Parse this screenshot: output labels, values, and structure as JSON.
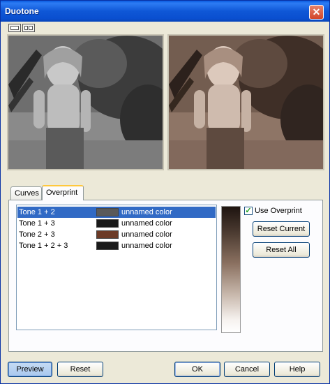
{
  "window": {
    "title": "Duotone",
    "close_glyph": "✕"
  },
  "tabs": [
    {
      "label": "Curves"
    },
    {
      "label": "Overprint"
    }
  ],
  "overprint": {
    "rows": [
      {
        "name": "Tone 1 + 2",
        "color": "#5a5a5a",
        "color_name": "unnamed color",
        "selected": true
      },
      {
        "name": "Tone 1 + 3",
        "color": "#1a1a1a",
        "color_name": "unnamed color",
        "selected": false
      },
      {
        "name": "Tone 2 + 3",
        "color": "#6b3a26",
        "color_name": "unnamed color",
        "selected": false
      },
      {
        "name": "Tone 1 + 2 + 3",
        "color": "#1a1a1a",
        "color_name": "unnamed color",
        "selected": false
      }
    ],
    "use_overprint": {
      "label": "Use Overprint",
      "checked": true,
      "glyph": "✓"
    },
    "reset_current_label": "Reset Current",
    "reset_all_label": "Reset All"
  },
  "footer": {
    "preview_label": "Preview",
    "reset_label": "Reset",
    "ok_label": "OK",
    "cancel_label": "Cancel",
    "help_label": "Help"
  },
  "colors": {
    "selection": "#316ac5",
    "title_bar": "#0a4fd0"
  }
}
